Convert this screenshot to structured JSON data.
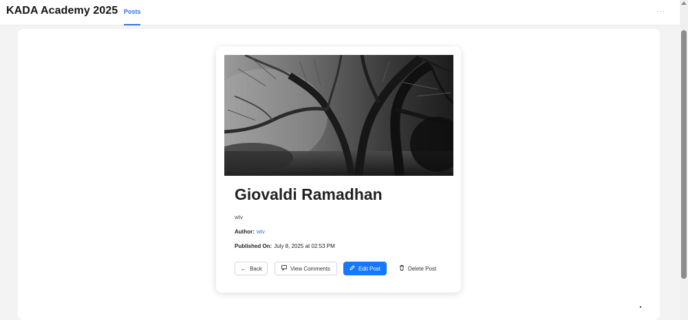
{
  "header": {
    "brand": "KADA Academy 2025",
    "nav": [
      {
        "label": "Posts",
        "active": true
      }
    ],
    "more": "···"
  },
  "post": {
    "image_alt": "Black and white photo of large bare trees in fog",
    "title": "Giovaldi Ramadhan",
    "body": "wtv",
    "author_label": "Author:",
    "author_value": "wtv",
    "published_label": "Published On:",
    "published_value": "July 8, 2025 at 02:53 PM"
  },
  "actions": {
    "back": {
      "label": "Back",
      "icon": "arrow-left-icon"
    },
    "view_comments": {
      "label": "View Comments",
      "icon": "comment-icon"
    },
    "edit": {
      "label": "Edit Post",
      "icon": "pencil-icon"
    },
    "delete": {
      "label": "Delete Post",
      "icon": "trash-icon"
    }
  },
  "colors": {
    "accent": "#1677ff",
    "nav_active": "#2f6fe0",
    "page_bg": "#f3f3f3"
  }
}
